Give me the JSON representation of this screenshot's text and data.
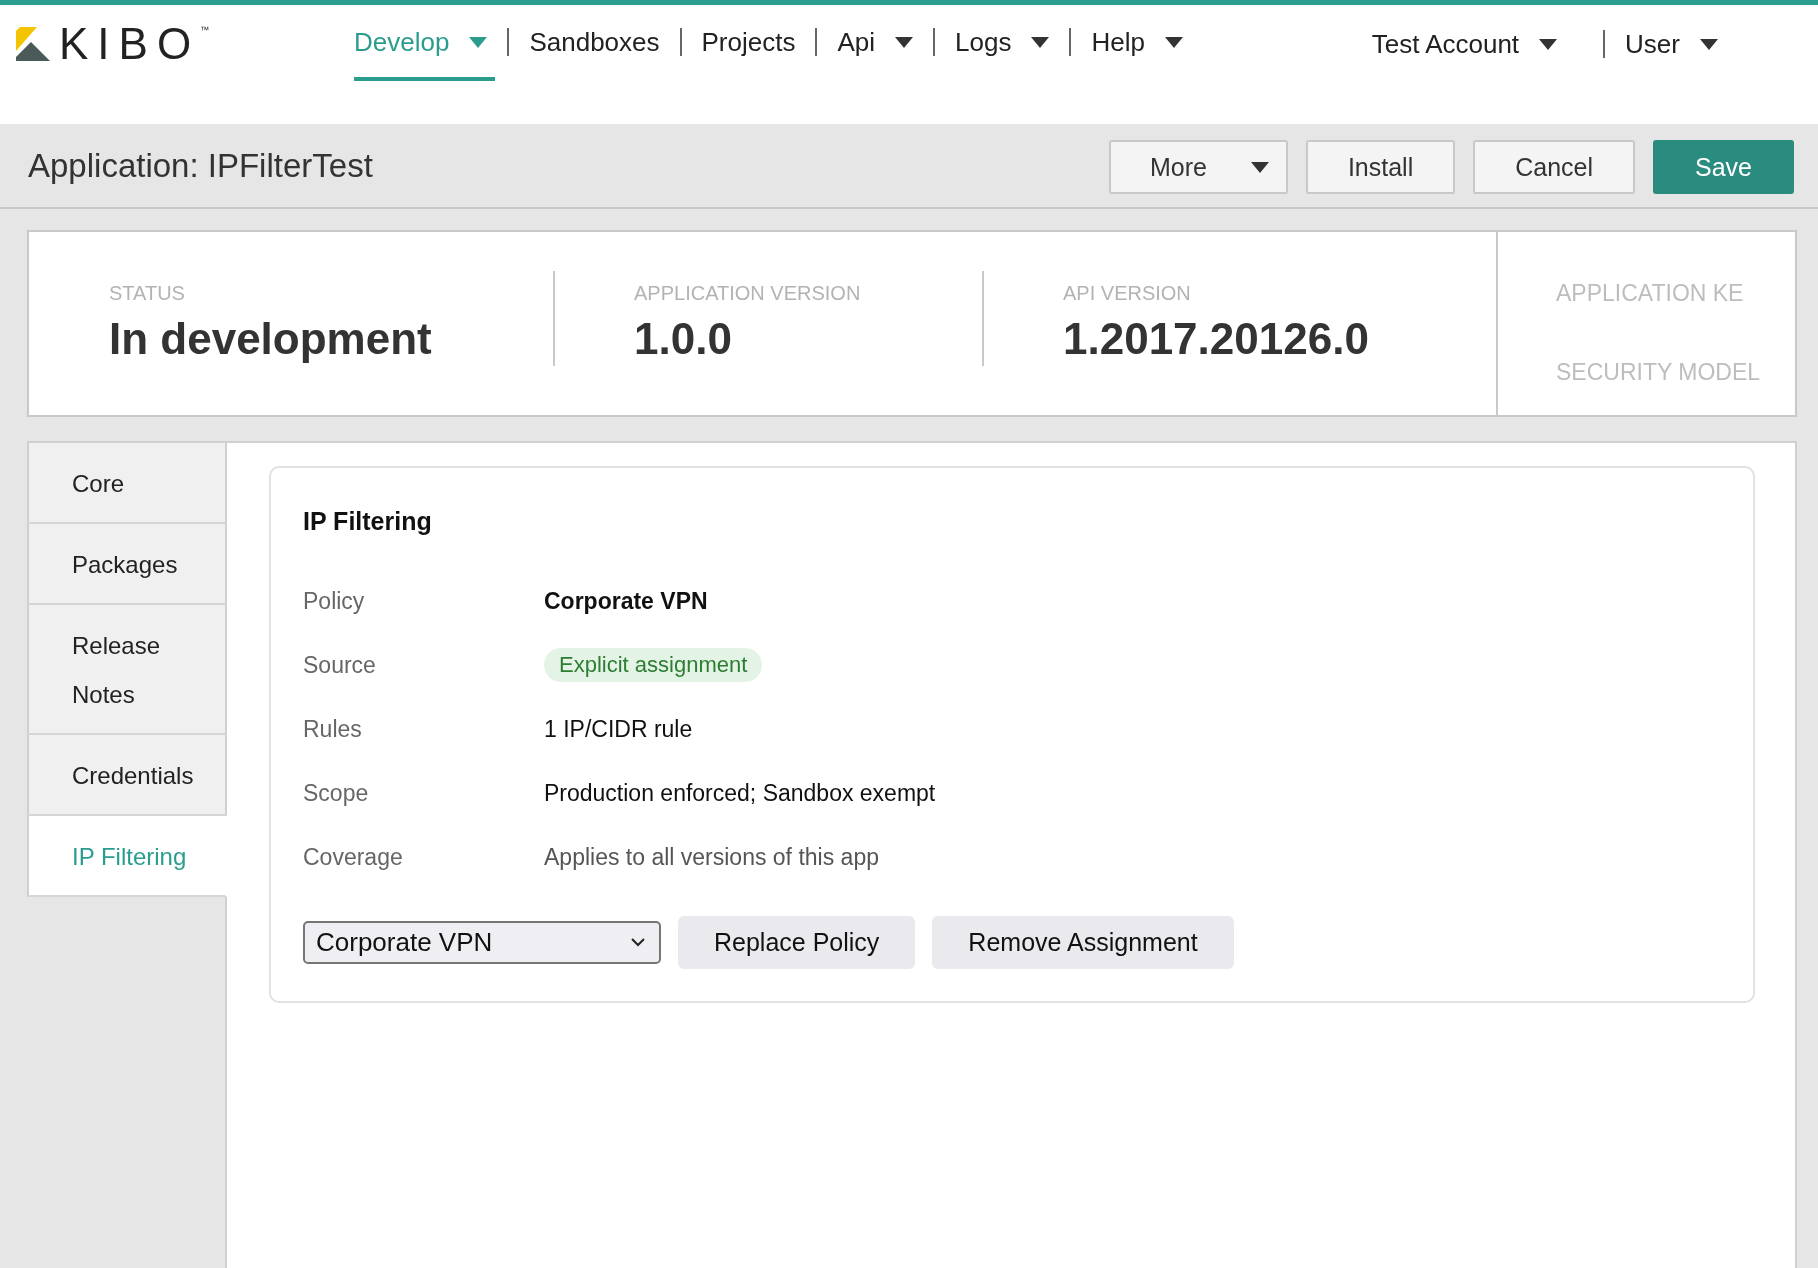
{
  "logo": {
    "wordmark": "KIBO$^{™}$"
  },
  "nav": {
    "items": [
      {
        "label": "Develop",
        "selected": true,
        "dropdown": true
      },
      {
        "label": "Sandboxes",
        "selected": false,
        "dropdown": false
      },
      {
        "label": "Projects",
        "selected": false,
        "dropdown": false
      },
      {
        "label": "Api",
        "selected": false,
        "dropdown": true
      },
      {
        "label": "Logs",
        "selected": false,
        "dropdown": true
      },
      {
        "label": "Help",
        "selected": false,
        "dropdown": true
      }
    ],
    "account_menu": [
      {
        "label": "Test Account",
        "dropdown": true
      },
      {
        "label": "User",
        "dropdown": true
      }
    ]
  },
  "page_header": {
    "title": "Application: IPFilterTest",
    "buttons": [
      {
        "label": "More",
        "kind": "dropdown"
      },
      {
        "label": "Install",
        "kind": "default"
      },
      {
        "label": "Cancel",
        "kind": "default"
      },
      {
        "label": "Save",
        "kind": "primary"
      }
    ]
  },
  "summary": {
    "fields": [
      {
        "label": "STATUS",
        "value": "In development"
      },
      {
        "label": "APPLICATION VERSION",
        "value": "1.0.0"
      },
      {
        "label": "API VERSION",
        "value": "1.2017.20126.0"
      }
    ],
    "side_labels": [
      "APPLICATION KE",
      "SECURITY MODEL"
    ]
  },
  "sidebar": {
    "items": [
      {
        "label": "Core",
        "selected": false
      },
      {
        "label": "Packages",
        "selected": false
      },
      {
        "label": "Release Notes",
        "selected": false
      },
      {
        "label": "Credentials",
        "selected": false
      },
      {
        "label": "IP Filtering",
        "selected": true
      }
    ]
  },
  "card": {
    "title": "IP Filtering",
    "rows": [
      {
        "label": "Policy",
        "value": "Corporate VPN",
        "kind": "strong"
      },
      {
        "label": "Source",
        "value": "Explicit assignment",
        "kind": "badge"
      },
      {
        "label": "Rules",
        "value": "1 IP/CIDR rule",
        "kind": "plain"
      },
      {
        "label": "Scope",
        "value": "Production enforced; Sandbox exempt",
        "kind": "plain"
      },
      {
        "label": "Coverage",
        "value": "Applies to all versions of this app",
        "kind": "muted"
      }
    ],
    "policy_select": {
      "value": "Corporate VPN"
    },
    "actions": [
      "Replace Policy",
      "Remove Assignment"
    ]
  }
}
